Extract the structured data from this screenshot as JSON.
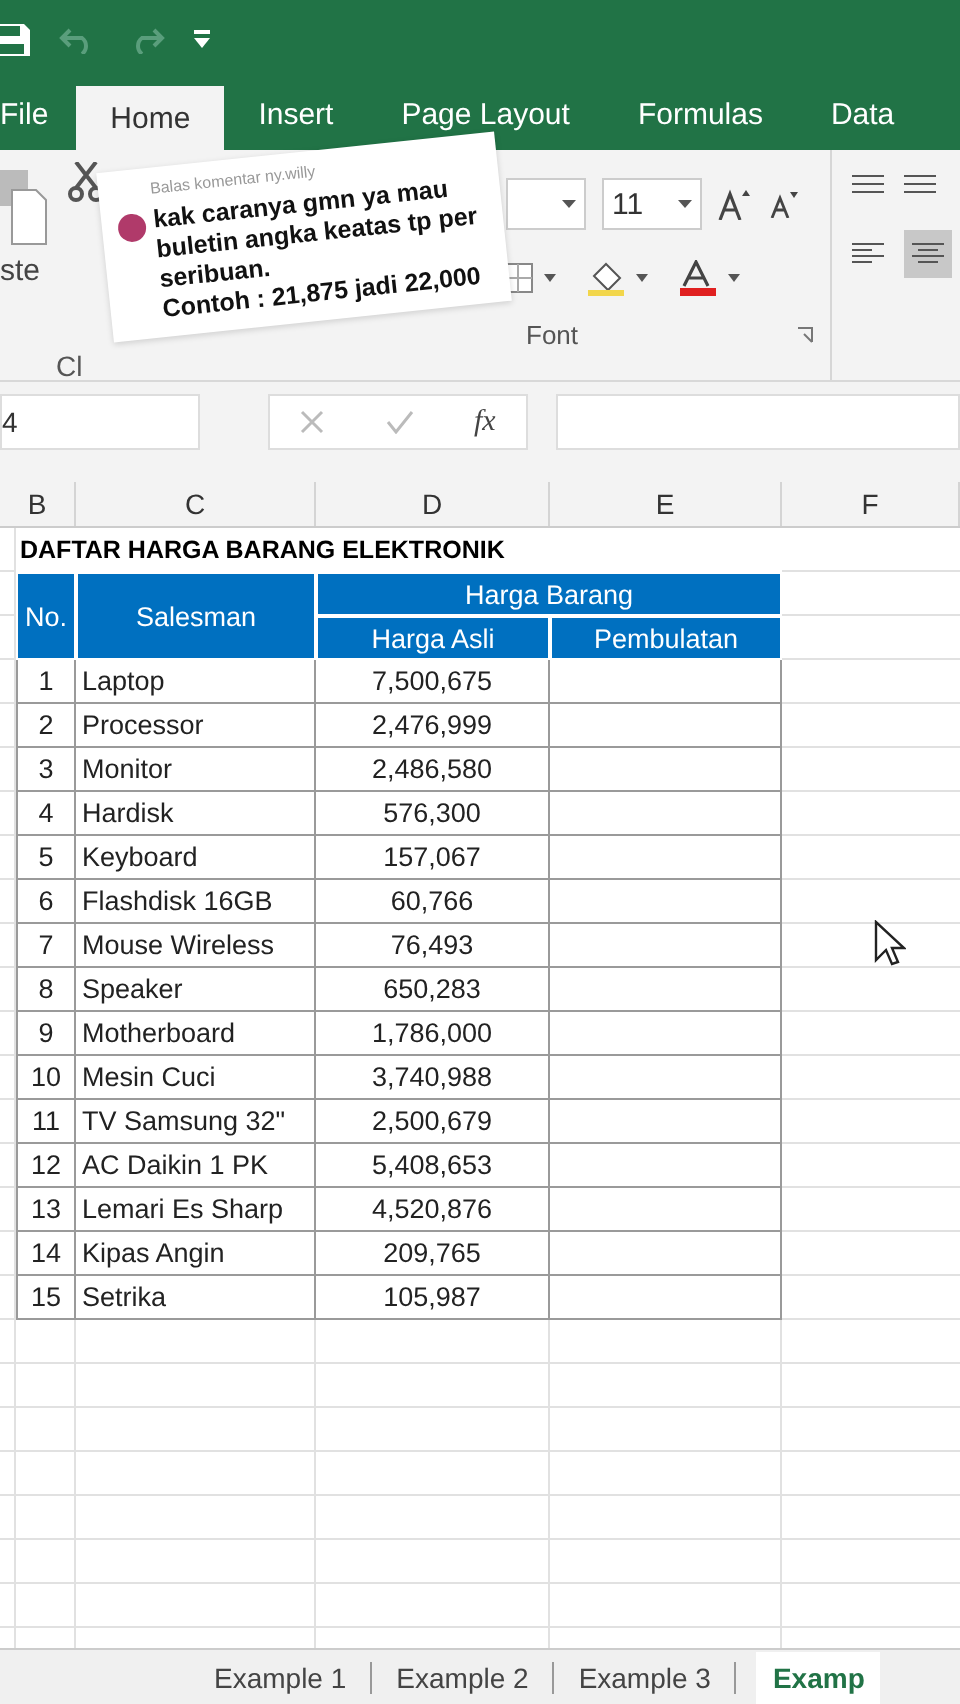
{
  "ribbon_tabs": [
    {
      "label": "File",
      "selected": false
    },
    {
      "label": "Home",
      "selected": true
    },
    {
      "label": "Insert",
      "selected": false
    },
    {
      "label": "Page Layout",
      "selected": false
    },
    {
      "label": "Formulas",
      "selected": false
    },
    {
      "label": "Data",
      "selected": false
    }
  ],
  "ribbon": {
    "clipboard_fragments": [
      "ste",
      "Cl"
    ],
    "font_size": "11",
    "font_group_label": "Font"
  },
  "formula_bar": {
    "name_box": "4",
    "function_label": "fx"
  },
  "columns": [
    "B",
    "C",
    "D",
    "E",
    "F"
  ],
  "sheet": {
    "title": "DAFTAR HARGA BARANG ELEKTRONIK",
    "headers": {
      "no": "No.",
      "salesman": "Salesman",
      "group": "Harga Barang",
      "original": "Harga Asli",
      "rounded": "Pembulatan"
    },
    "rows": [
      {
        "no": "1",
        "name": "Laptop",
        "price": "7,500,675"
      },
      {
        "no": "2",
        "name": "Processor",
        "price": "2,476,999"
      },
      {
        "no": "3",
        "name": "Monitor",
        "price": "2,486,580"
      },
      {
        "no": "4",
        "name": "Hardisk",
        "price": "576,300"
      },
      {
        "no": "5",
        "name": "Keyboard",
        "price": "157,067"
      },
      {
        "no": "6",
        "name": "Flashdisk 16GB",
        "price": "60,766"
      },
      {
        "no": "7",
        "name": "Mouse Wireless",
        "price": "76,493"
      },
      {
        "no": "8",
        "name": "Speaker",
        "price": "650,283"
      },
      {
        "no": "9",
        "name": "Motherboard",
        "price": "1,786,000"
      },
      {
        "no": "10",
        "name": "Mesin Cuci",
        "price": "3,740,988"
      },
      {
        "no": "11",
        "name": "TV Samsung 32\"",
        "price": "2,500,679"
      },
      {
        "no": "12",
        "name": "AC Daikin 1 PK",
        "price": "5,408,653"
      },
      {
        "no": "13",
        "name": "Lemari Es Sharp",
        "price": "4,520,876"
      },
      {
        "no": "14",
        "name": "Kipas Angin",
        "price": "209,765"
      },
      {
        "no": "15",
        "name": "Setrika",
        "price": "105,987"
      }
    ]
  },
  "sheet_tabs": [
    {
      "label": "Example 1",
      "selected": false
    },
    {
      "label": "Example 2",
      "selected": false
    },
    {
      "label": "Example 3",
      "selected": false
    },
    {
      "label": "Examp",
      "selected": true
    }
  ],
  "comment": {
    "reply_to": "Balas komentar ny.willy",
    "lines": [
      "kak caranya gmn ya mau buletin angka keatas tp per seribuan.",
      "Contoh : 21,875 jadi 22,000"
    ]
  }
}
